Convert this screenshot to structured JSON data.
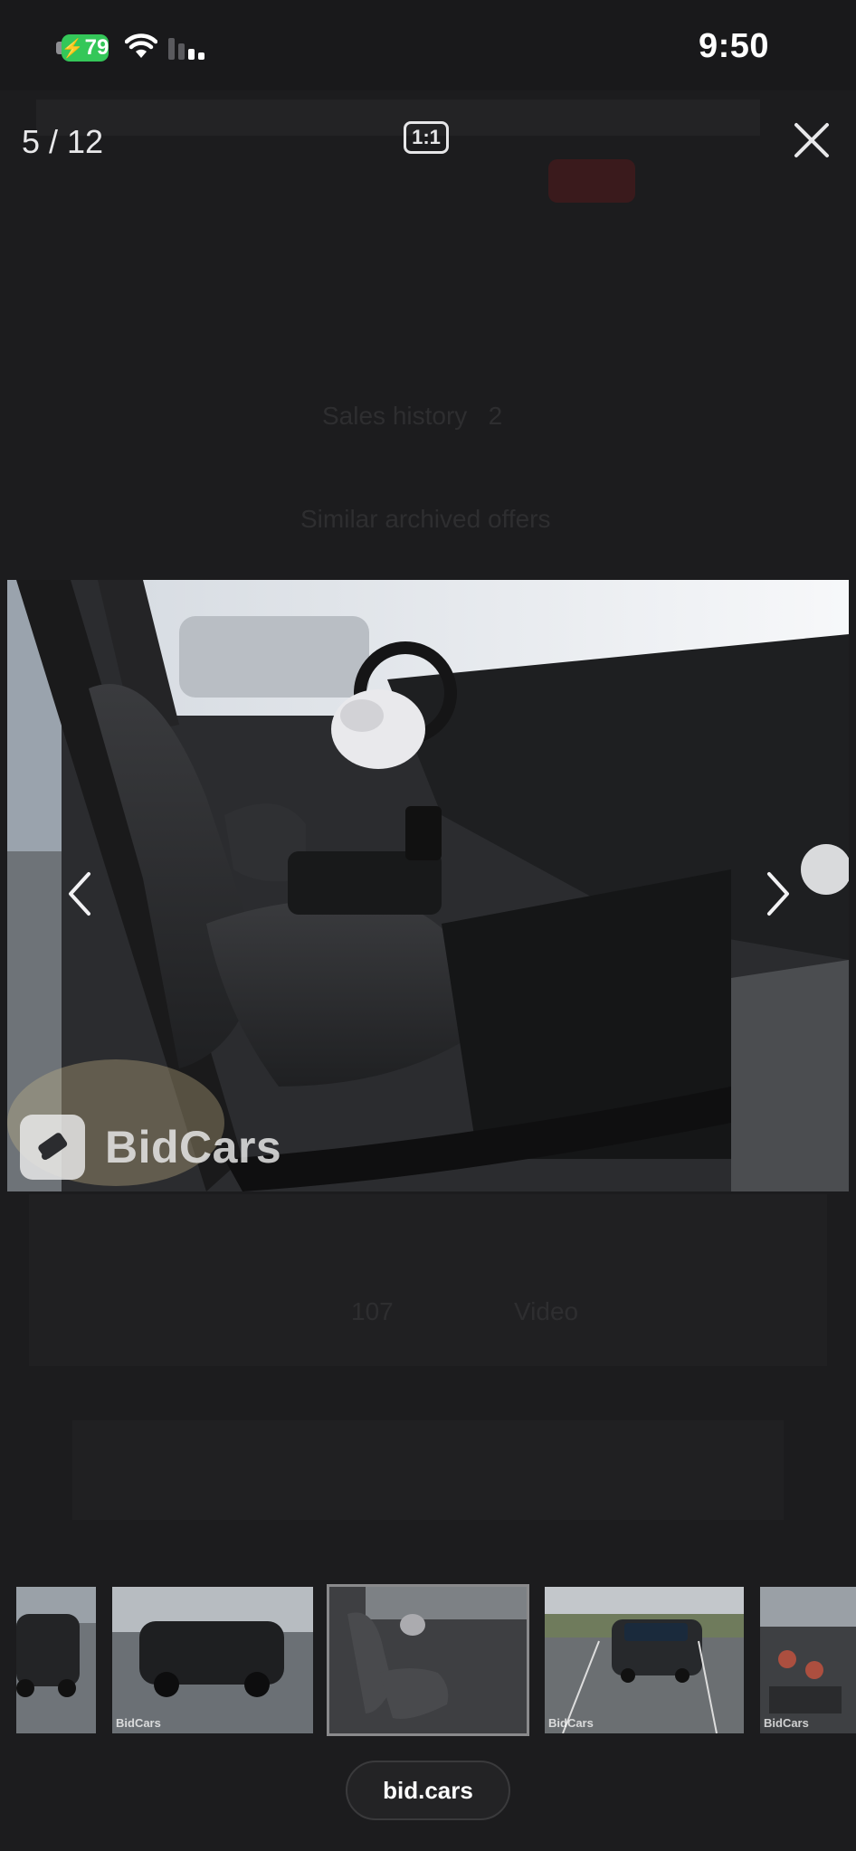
{
  "status_bar": {
    "battery": "79",
    "time": "9:50"
  },
  "viewer": {
    "counter": "5 / 12",
    "ratio_label": "1:1",
    "current_index": 5,
    "total_images": 12
  },
  "photo": {
    "description_icon": "car-interior-photo",
    "watermark": "BidCars"
  },
  "background": {
    "heading": "Sales history",
    "heading_count": "2",
    "similar": "Similar archived offers",
    "tab_count": "107",
    "tab_video": "Video"
  },
  "thumbnails": [
    {
      "icon": "car-rear-photo",
      "watermark": ""
    },
    {
      "icon": "car-side-photo",
      "watermark": "BidCars"
    },
    {
      "icon": "car-interior-photo",
      "watermark": "",
      "active": true
    },
    {
      "icon": "car-front-damage-photo",
      "watermark": "BidCars"
    },
    {
      "icon": "dashboard-photo",
      "watermark": "BidCars"
    }
  ],
  "url_bar": {
    "domain": "bid.cars"
  },
  "colors": {
    "battery": "#34c759",
    "background": "#1c1c1e"
  }
}
